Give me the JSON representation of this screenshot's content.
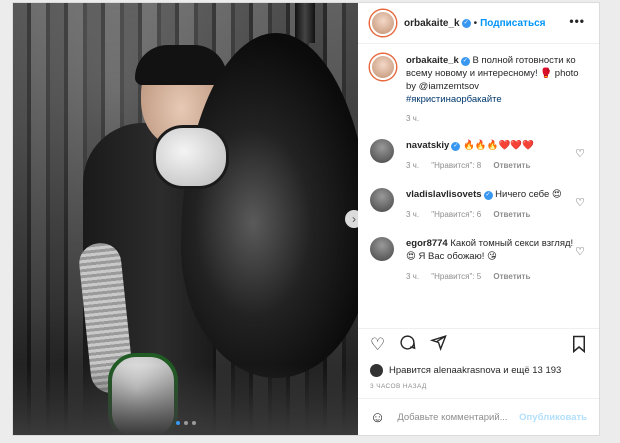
{
  "header": {
    "username": "orbakaite_k",
    "separator": "•",
    "follow_label": "Подписаться",
    "more_label": "•••"
  },
  "caption": {
    "username": "orbakaite_k",
    "text": "В полной готовности ко всему новому и интересному! 🥊 photo by @iamzemtsov",
    "hashtag": "#якристинаорбакайте",
    "time": "3 ч."
  },
  "comments": [
    {
      "username": "navatskiy",
      "text": "🔥🔥🔥❤️❤️❤️",
      "time": "3 ч.",
      "likes": "\"Нравится\": 8",
      "reply": "Ответить"
    },
    {
      "username": "vladislavlisovets",
      "text": "Ничего себе 😍",
      "time": "3 ч.",
      "likes": "\"Нравится\": 6",
      "reply": "Ответить"
    },
    {
      "username": "egor8774",
      "text": "Какой томный секси взгляд! 😍 Я Вас обожаю! 😘",
      "time": "3 ч.",
      "likes": "\"Нравится\": 5",
      "reply": "Ответить"
    }
  ],
  "likes": {
    "text": "Нравится alenaakrasnova и ещё 13 193"
  },
  "posted_ago": "3 часов назад",
  "add_comment": {
    "placeholder": "Добавьте комментарий...",
    "publish": "Опубликовать"
  },
  "carousel": {
    "count": 3,
    "active_index": 0
  },
  "colors": {
    "accent": "#0095f6",
    "muted": "#8e8e8e",
    "text": "#262626"
  },
  "icons": [
    "more-icon",
    "verified-icon",
    "heart-icon",
    "comment-icon",
    "share-icon",
    "bookmark-icon",
    "smile-icon",
    "next-arrow-icon"
  ]
}
